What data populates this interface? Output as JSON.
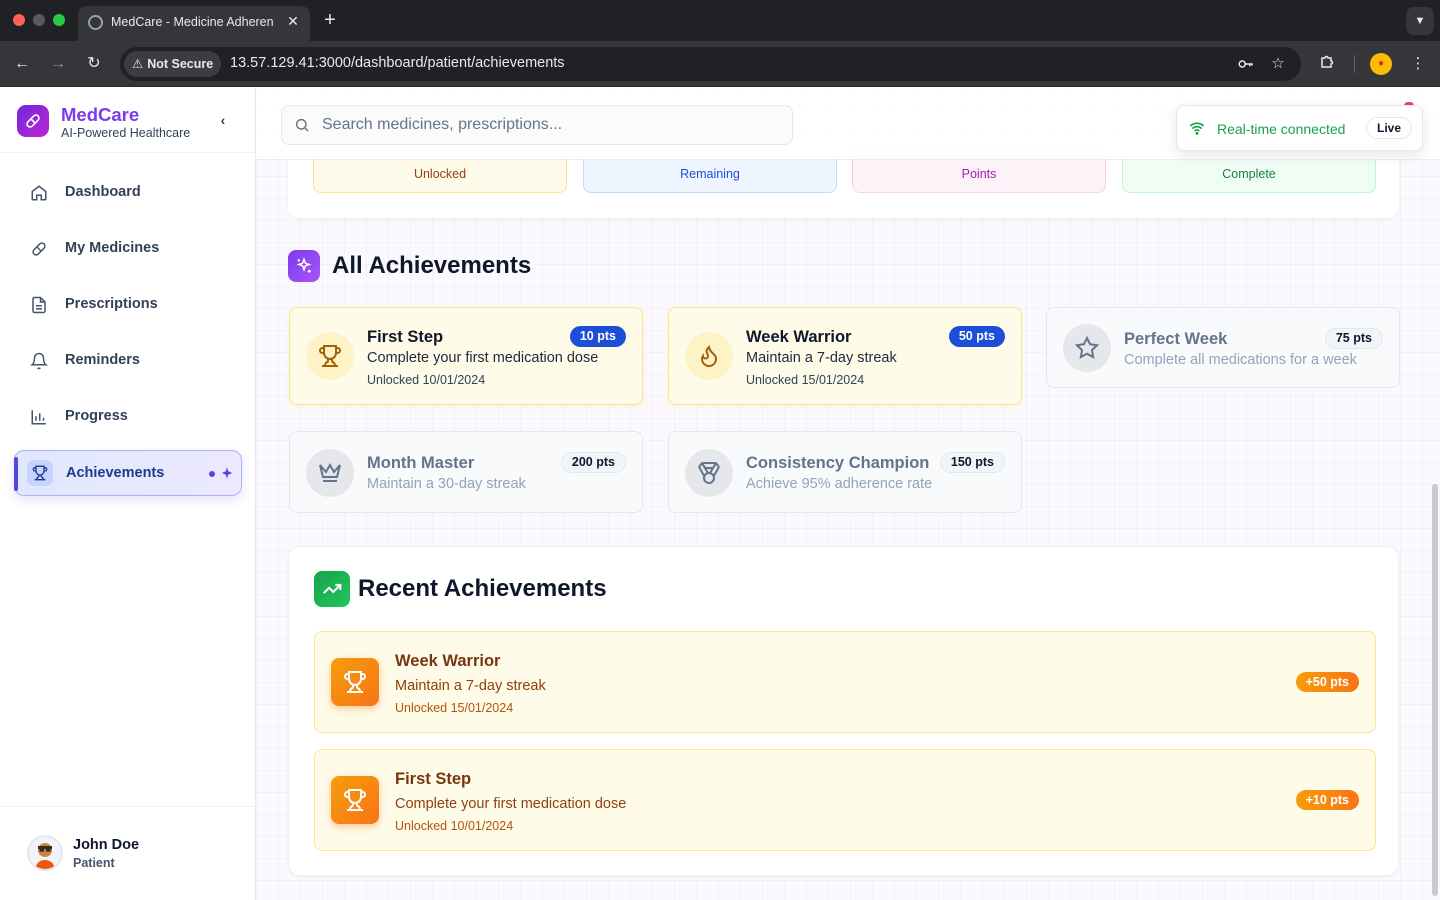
{
  "browser": {
    "tab_title": "MedCare - Medicine Adheren",
    "new_tab": "+",
    "close": "✕",
    "security_label": "Not Secure",
    "url": "13.57.129.41:3000/dashboard/patient/achievements"
  },
  "sidebar": {
    "brand_name": "MedCare",
    "brand_tagline": "AI-Powered Healthcare",
    "items": [
      {
        "label": "Dashboard",
        "icon": "home-icon"
      },
      {
        "label": "My Medicines",
        "icon": "pill-icon"
      },
      {
        "label": "Prescriptions",
        "icon": "document-icon"
      },
      {
        "label": "Reminders",
        "icon": "bell-icon"
      },
      {
        "label": "Progress",
        "icon": "bar-chart-icon"
      },
      {
        "label": "Achievements",
        "icon": "trophy-icon",
        "active": true
      }
    ],
    "user": {
      "name": "John Doe",
      "role": "Patient"
    }
  },
  "search": {
    "placeholder": "Search medicines, prescriptions..."
  },
  "realtime": {
    "status": "Real-time connected",
    "badge": "Live"
  },
  "stats": [
    "Unlocked",
    "Remaining",
    "Points",
    "Complete"
  ],
  "all_achievements": {
    "title": "All Achievements",
    "items": [
      {
        "title": "First Step",
        "desc": "Complete your first medication dose",
        "date": "Unlocked 10/01/2024",
        "points": "10 pts",
        "unlocked": true,
        "icon": "trophy-icon"
      },
      {
        "title": "Week Warrior",
        "desc": "Maintain a 7-day streak",
        "date": "Unlocked 15/01/2024",
        "points": "50 pts",
        "unlocked": true,
        "icon": "flame-icon"
      },
      {
        "title": "Perfect Week",
        "desc": "Complete all medications for a week",
        "points": "75 pts",
        "unlocked": false,
        "icon": "star-icon"
      },
      {
        "title": "Month Master",
        "desc": "Maintain a 30-day streak",
        "points": "200 pts",
        "unlocked": false,
        "icon": "crown-icon"
      },
      {
        "title": "Consistency Champion",
        "desc": "Achieve 95% adherence rate",
        "points": "150 pts",
        "unlocked": false,
        "icon": "medal-icon"
      }
    ]
  },
  "recent_achievements": {
    "title": "Recent Achievements",
    "items": [
      {
        "title": "Week Warrior",
        "desc": "Maintain a 7-day streak",
        "date": "Unlocked 15/01/2024",
        "points": "+50 pts"
      },
      {
        "title": "First Step",
        "desc": "Complete your first medication dose",
        "date": "Unlocked 10/01/2024",
        "points": "+10 pts"
      }
    ]
  },
  "colors": {
    "brand": "#7c3aed",
    "active_nav": "#4f46e5",
    "badge_blue": "#1d4ed8",
    "live_green": "#16a34a",
    "recent_orange": "#f97316"
  }
}
